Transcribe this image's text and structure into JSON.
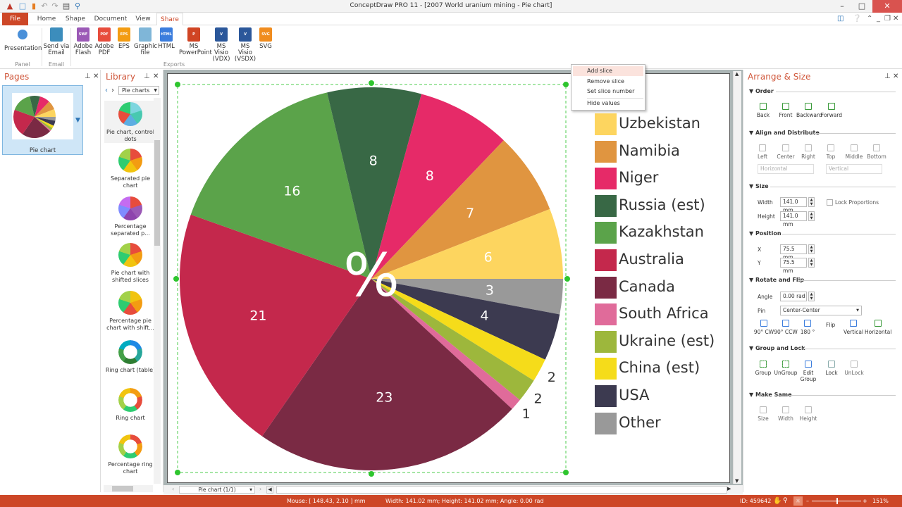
{
  "window": {
    "title": "ConceptDraw PRO 11 - [2007 World uranium mining - Pie chart]",
    "minimize": "–",
    "maximize": "□",
    "close": "✕"
  },
  "tabs": [
    {
      "label": "File"
    },
    {
      "label": "Home"
    },
    {
      "label": "Shape"
    },
    {
      "label": "Document"
    },
    {
      "label": "View"
    },
    {
      "label": "Share",
      "active": true
    }
  ],
  "ribbon": {
    "groups": [
      {
        "label": "Panel",
        "buttons": [
          {
            "label": "Presentation",
            "icon": "presentation-icon"
          }
        ]
      },
      {
        "label": "Email",
        "buttons": [
          {
            "label": "Send via Email",
            "icon": "email-icon"
          }
        ]
      },
      {
        "label": "Exports",
        "buttons": [
          {
            "label": "Adobe Flash",
            "icon": "swf-icon",
            "badge": "SWF",
            "color": "#9b59b6"
          },
          {
            "label": "Adobe PDF",
            "icon": "pdf-icon",
            "badge": "PDF",
            "color": "#e74c3c"
          },
          {
            "label": "EPS",
            "icon": "eps-icon",
            "badge": "EPS",
            "color": "#f39c12"
          },
          {
            "label": "Graphic file",
            "icon": "image-icon",
            "badge": "",
            "color": "#7fb6d8"
          },
          {
            "label": "HTML",
            "icon": "html-icon",
            "badge": "HTML",
            "color": "#3b7ddd"
          },
          {
            "label": "MS PowerPoint",
            "icon": "powerpoint-icon",
            "badge": "P",
            "color": "#d04423"
          },
          {
            "label": "MS Visio (VDX)",
            "icon": "visio-vdx-icon",
            "badge": "V",
            "color": "#2b579a"
          },
          {
            "label": "MS Visio (VSDX)",
            "icon": "visio-vsdx-icon",
            "badge": "V",
            "color": "#2b579a"
          },
          {
            "label": "SVG",
            "icon": "svg-icon",
            "badge": "SVG",
            "color": "#f08c1e"
          }
        ]
      }
    ]
  },
  "pages_pane": {
    "title": "Pages",
    "pages": [
      {
        "label": "Pie chart"
      }
    ]
  },
  "library_pane": {
    "title": "Library",
    "selected_library": "Pie charts",
    "items": [
      {
        "label": "Pie chart, control dots"
      },
      {
        "label": "Separated pie chart"
      },
      {
        "label": "Percentage separated p..."
      },
      {
        "label": "Pie chart with shifted slices"
      },
      {
        "label": "Percentage pie chart with shift..."
      },
      {
        "label": "Ring chart (table)"
      },
      {
        "label": "Ring chart"
      },
      {
        "label": "Percentage ring chart"
      }
    ]
  },
  "context_menu": {
    "items": [
      {
        "label": "Add slice",
        "highlighted": true
      },
      {
        "label": "Remove slice"
      },
      {
        "label": "Set slice number"
      },
      {
        "label": "Hide values"
      }
    ]
  },
  "chart_data": {
    "type": "pie",
    "title": "",
    "center_label": "%",
    "start": "3 o'clock, clockwise",
    "slices": [
      {
        "label": "Other",
        "value": 3,
        "color": "#999999"
      },
      {
        "label": "USA",
        "value": 4,
        "color": "#3c3a50"
      },
      {
        "label": "China (est)",
        "value": 2,
        "color": "#f5dc1a"
      },
      {
        "label": "Ukraine (est)",
        "value": 2,
        "color": "#9db73c"
      },
      {
        "label": "South Africa",
        "value": 1,
        "color": "#e06b9a"
      },
      {
        "label": "Canada",
        "value": 23,
        "color": "#7a2a44"
      },
      {
        "label": "Australia",
        "value": 21,
        "color": "#c4284c"
      },
      {
        "label": "Kazakhstan",
        "value": 16,
        "color": "#5ba34a"
      },
      {
        "label": "Russia (est)",
        "value": 8,
        "color": "#386845"
      },
      {
        "label": "Niger",
        "value": 8,
        "color": "#e62a68"
      },
      {
        "label": "Namibia",
        "value": 7,
        "color": "#e09540"
      },
      {
        "label": "Uzbekistan",
        "value": 6,
        "color": "#fdd55f"
      }
    ],
    "legend": [
      "Uzbekistan",
      "Namibia",
      "Niger",
      "Russia (est)",
      "Kazakhstan",
      "Australia",
      "Canada",
      "South Africa",
      "Ukraine (est)",
      "China (est)",
      "USA",
      "Other"
    ],
    "legend_placement": "right"
  },
  "arrange_pane": {
    "title": "Arrange & Size",
    "sections": {
      "order": {
        "title": "Order",
        "buttons": [
          "Back",
          "Front",
          "Backward",
          "Forward"
        ]
      },
      "align": {
        "title": "Align and Distribute",
        "buttons": [
          "Left",
          "Center",
          "Right",
          "Top",
          "Middle",
          "Bottom"
        ],
        "horizontal": "Horizontal",
        "vertical": "Vertical"
      },
      "size": {
        "title": "Size",
        "width_label": "Width",
        "width": "141.0 mm",
        "height_label": "Height",
        "height": "141.0 mm",
        "lock": "Lock Proportions"
      },
      "position": {
        "title": "Position",
        "x_label": "X",
        "x": "75.5 mm",
        "y_label": "Y",
        "y": "75.5 mm"
      },
      "rotate": {
        "title": "Rotate and Flip",
        "angle_label": "Angle",
        "angle": "0.00 rad",
        "pin_label": "Pin",
        "pin": "Center-Center",
        "buttons": [
          "90° CW",
          "90° CCW",
          "180 °"
        ],
        "flip_label": "Flip",
        "flip_buttons": [
          "Vertical",
          "Horizontal"
        ]
      },
      "group": {
        "title": "Group and Lock",
        "buttons": [
          "Group",
          "UnGroup",
          "Edit Group",
          "Lock",
          "UnLock"
        ]
      },
      "same": {
        "title": "Make Same",
        "buttons": [
          "Size",
          "Width",
          "Height"
        ]
      }
    }
  },
  "page_nav": {
    "current": "Pie chart (1/1)"
  },
  "status": {
    "mouse": "Mouse: [ 148.43, 2.10 ] mm",
    "dims": "Width: 141.02 mm;  Height: 141.02 mm;  Angle: 0.00 rad",
    "id": "ID: 459642",
    "zoom": "151%",
    "zoom_fraction": 0.5
  }
}
